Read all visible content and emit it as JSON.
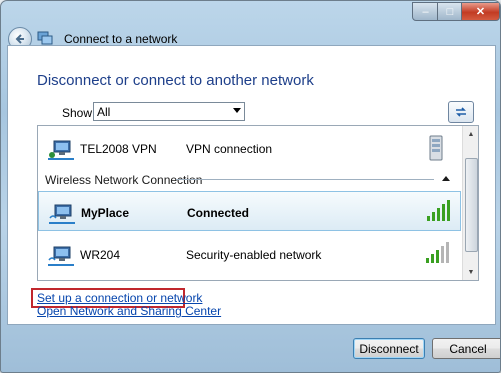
{
  "window": {
    "title": "Connect to a network",
    "controls": {
      "minimize": "–",
      "maximize": "□",
      "close": "✕"
    }
  },
  "main": {
    "heading": "Disconnect or connect to another network",
    "show_label": "Show",
    "show_value": "All"
  },
  "networks": [
    {
      "name": "TEL2008 VPN",
      "status": "VPN connection",
      "icon": "vpn-network-icon",
      "right_icon": "server-icon",
      "selected": false
    },
    {
      "name": "MyPlace",
      "status": "Connected",
      "icon": "wireless-network-icon",
      "signal": 5,
      "selected": true
    },
    {
      "name": "WR204",
      "status": "Security-enabled network",
      "icon": "wireless-network-icon",
      "signal": 3,
      "selected": false
    }
  ],
  "group_label": "Wireless Network Connection",
  "links": {
    "setup": "Set up a connection or network",
    "sharing_center": "Open Network and Sharing Center"
  },
  "buttons": {
    "disconnect": "Disconnect",
    "cancel": "Cancel"
  },
  "colors": {
    "heading": "#1e3f8a",
    "link": "#0645ad",
    "highlight": "#c1272d",
    "signal_active": "#3aa021",
    "signal_inactive": "#b5b5b5"
  }
}
